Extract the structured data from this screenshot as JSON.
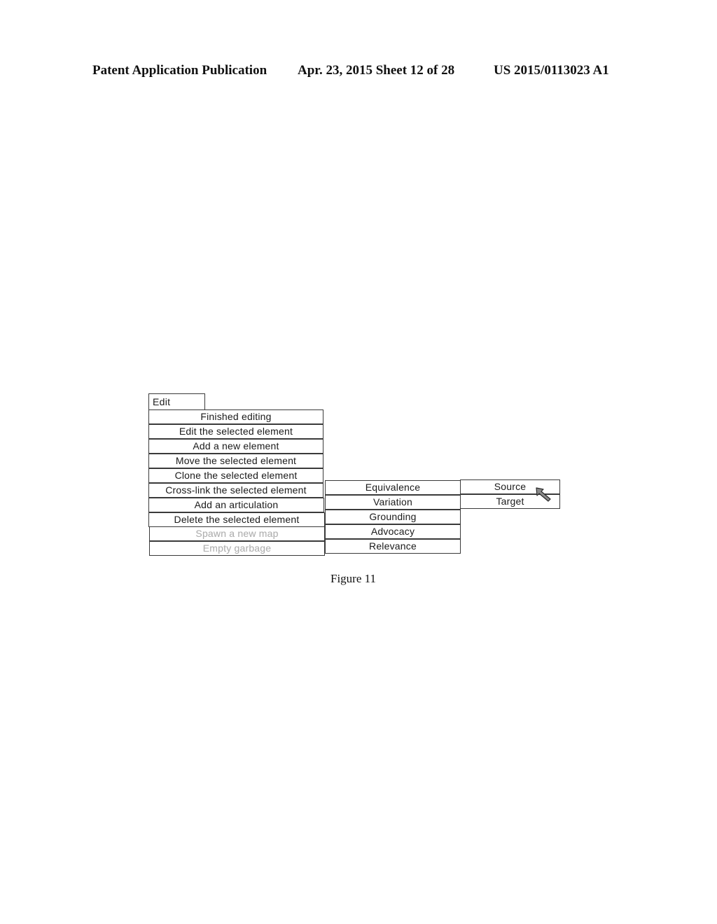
{
  "header": {
    "publication": "Patent Application Publication",
    "date_sheet": "Apr. 23, 2015  Sheet 12 of 28",
    "number": "US 2015/0113023 A1"
  },
  "edit_menu": {
    "label": "Edit",
    "items": [
      {
        "label": "Finished editing",
        "enabled": true
      },
      {
        "label": "Edit the selected  element",
        "enabled": true
      },
      {
        "label": "Add a new element",
        "enabled": true
      },
      {
        "label": "Move the selected element",
        "enabled": true
      },
      {
        "label": "Clone the selected element",
        "enabled": true
      },
      {
        "label": "Cross-link the selected element",
        "enabled": true
      },
      {
        "label": "Add an articulation",
        "enabled": true
      },
      {
        "label": "Delete the selected element",
        "enabled": true
      },
      {
        "label": "Spawn a new map",
        "enabled": false
      },
      {
        "label": "Empty garbage",
        "enabled": false
      }
    ]
  },
  "crosslink_submenu": {
    "items": [
      "Equivalence",
      "Variation",
      "Grounding",
      "Advocacy",
      "Relevance"
    ]
  },
  "direction_submenu": {
    "items": [
      "Source",
      "Target"
    ]
  },
  "cursor": {
    "icon": "arrow-pointer-icon",
    "hovering": "Source"
  },
  "caption": "Figure 11"
}
